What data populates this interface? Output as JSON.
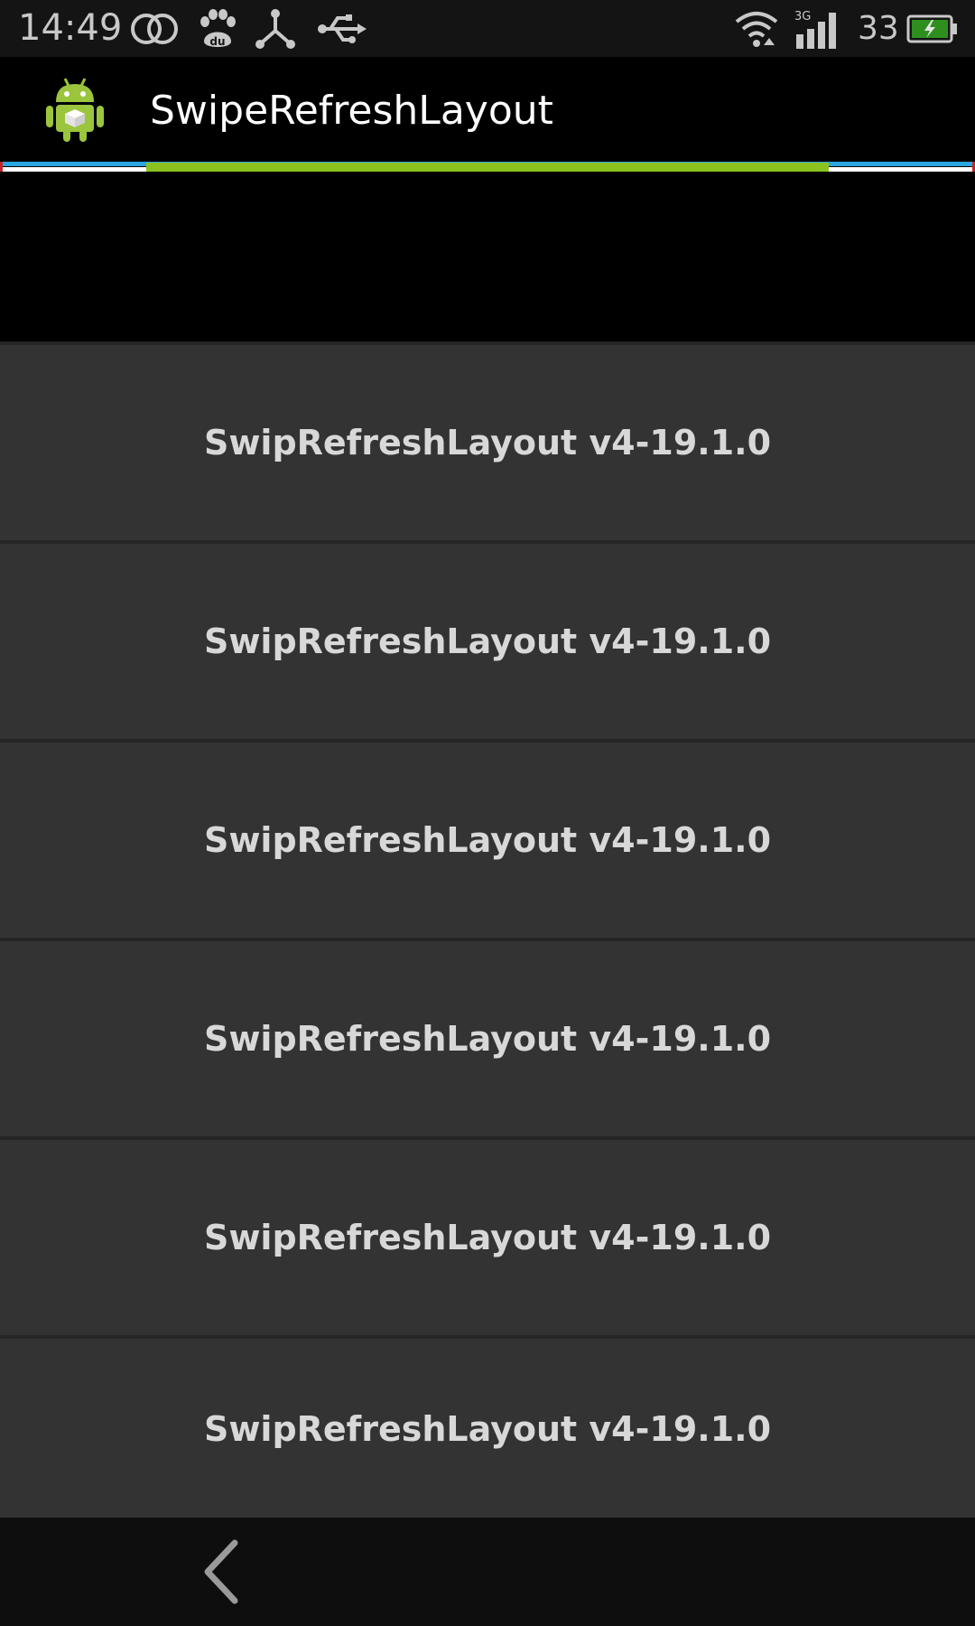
{
  "status_bar": {
    "time": "14:49",
    "signal_label": "3G",
    "battery_level_text": "33",
    "icons": [
      "circles-icon",
      "baidu-paw-icon",
      "usb-share-icon",
      "usb-icon",
      "wifi-icon",
      "signal-icon",
      "battery-charging-icon"
    ]
  },
  "action_bar": {
    "title": "SwipeRefreshLayout",
    "icon": "android-app-icon"
  },
  "refresh_indicator": {
    "progress_fraction": 0.7,
    "colors": {
      "green": "#8cc21f",
      "blue": "#2aa6e0",
      "white": "#ffffff",
      "red": "#c0262b"
    }
  },
  "list": {
    "items": [
      {
        "label": "SwipRefreshLayout v4-19.1.0"
      },
      {
        "label": "SwipRefreshLayout v4-19.1.0"
      },
      {
        "label": "SwipRefreshLayout v4-19.1.0"
      },
      {
        "label": "SwipRefreshLayout v4-19.1.0"
      },
      {
        "label": "SwipRefreshLayout v4-19.1.0"
      },
      {
        "label": "SwipRefreshLayout v4-19.1.0"
      }
    ]
  },
  "nav_bar": {
    "back_icon": "back-chevron-icon"
  }
}
